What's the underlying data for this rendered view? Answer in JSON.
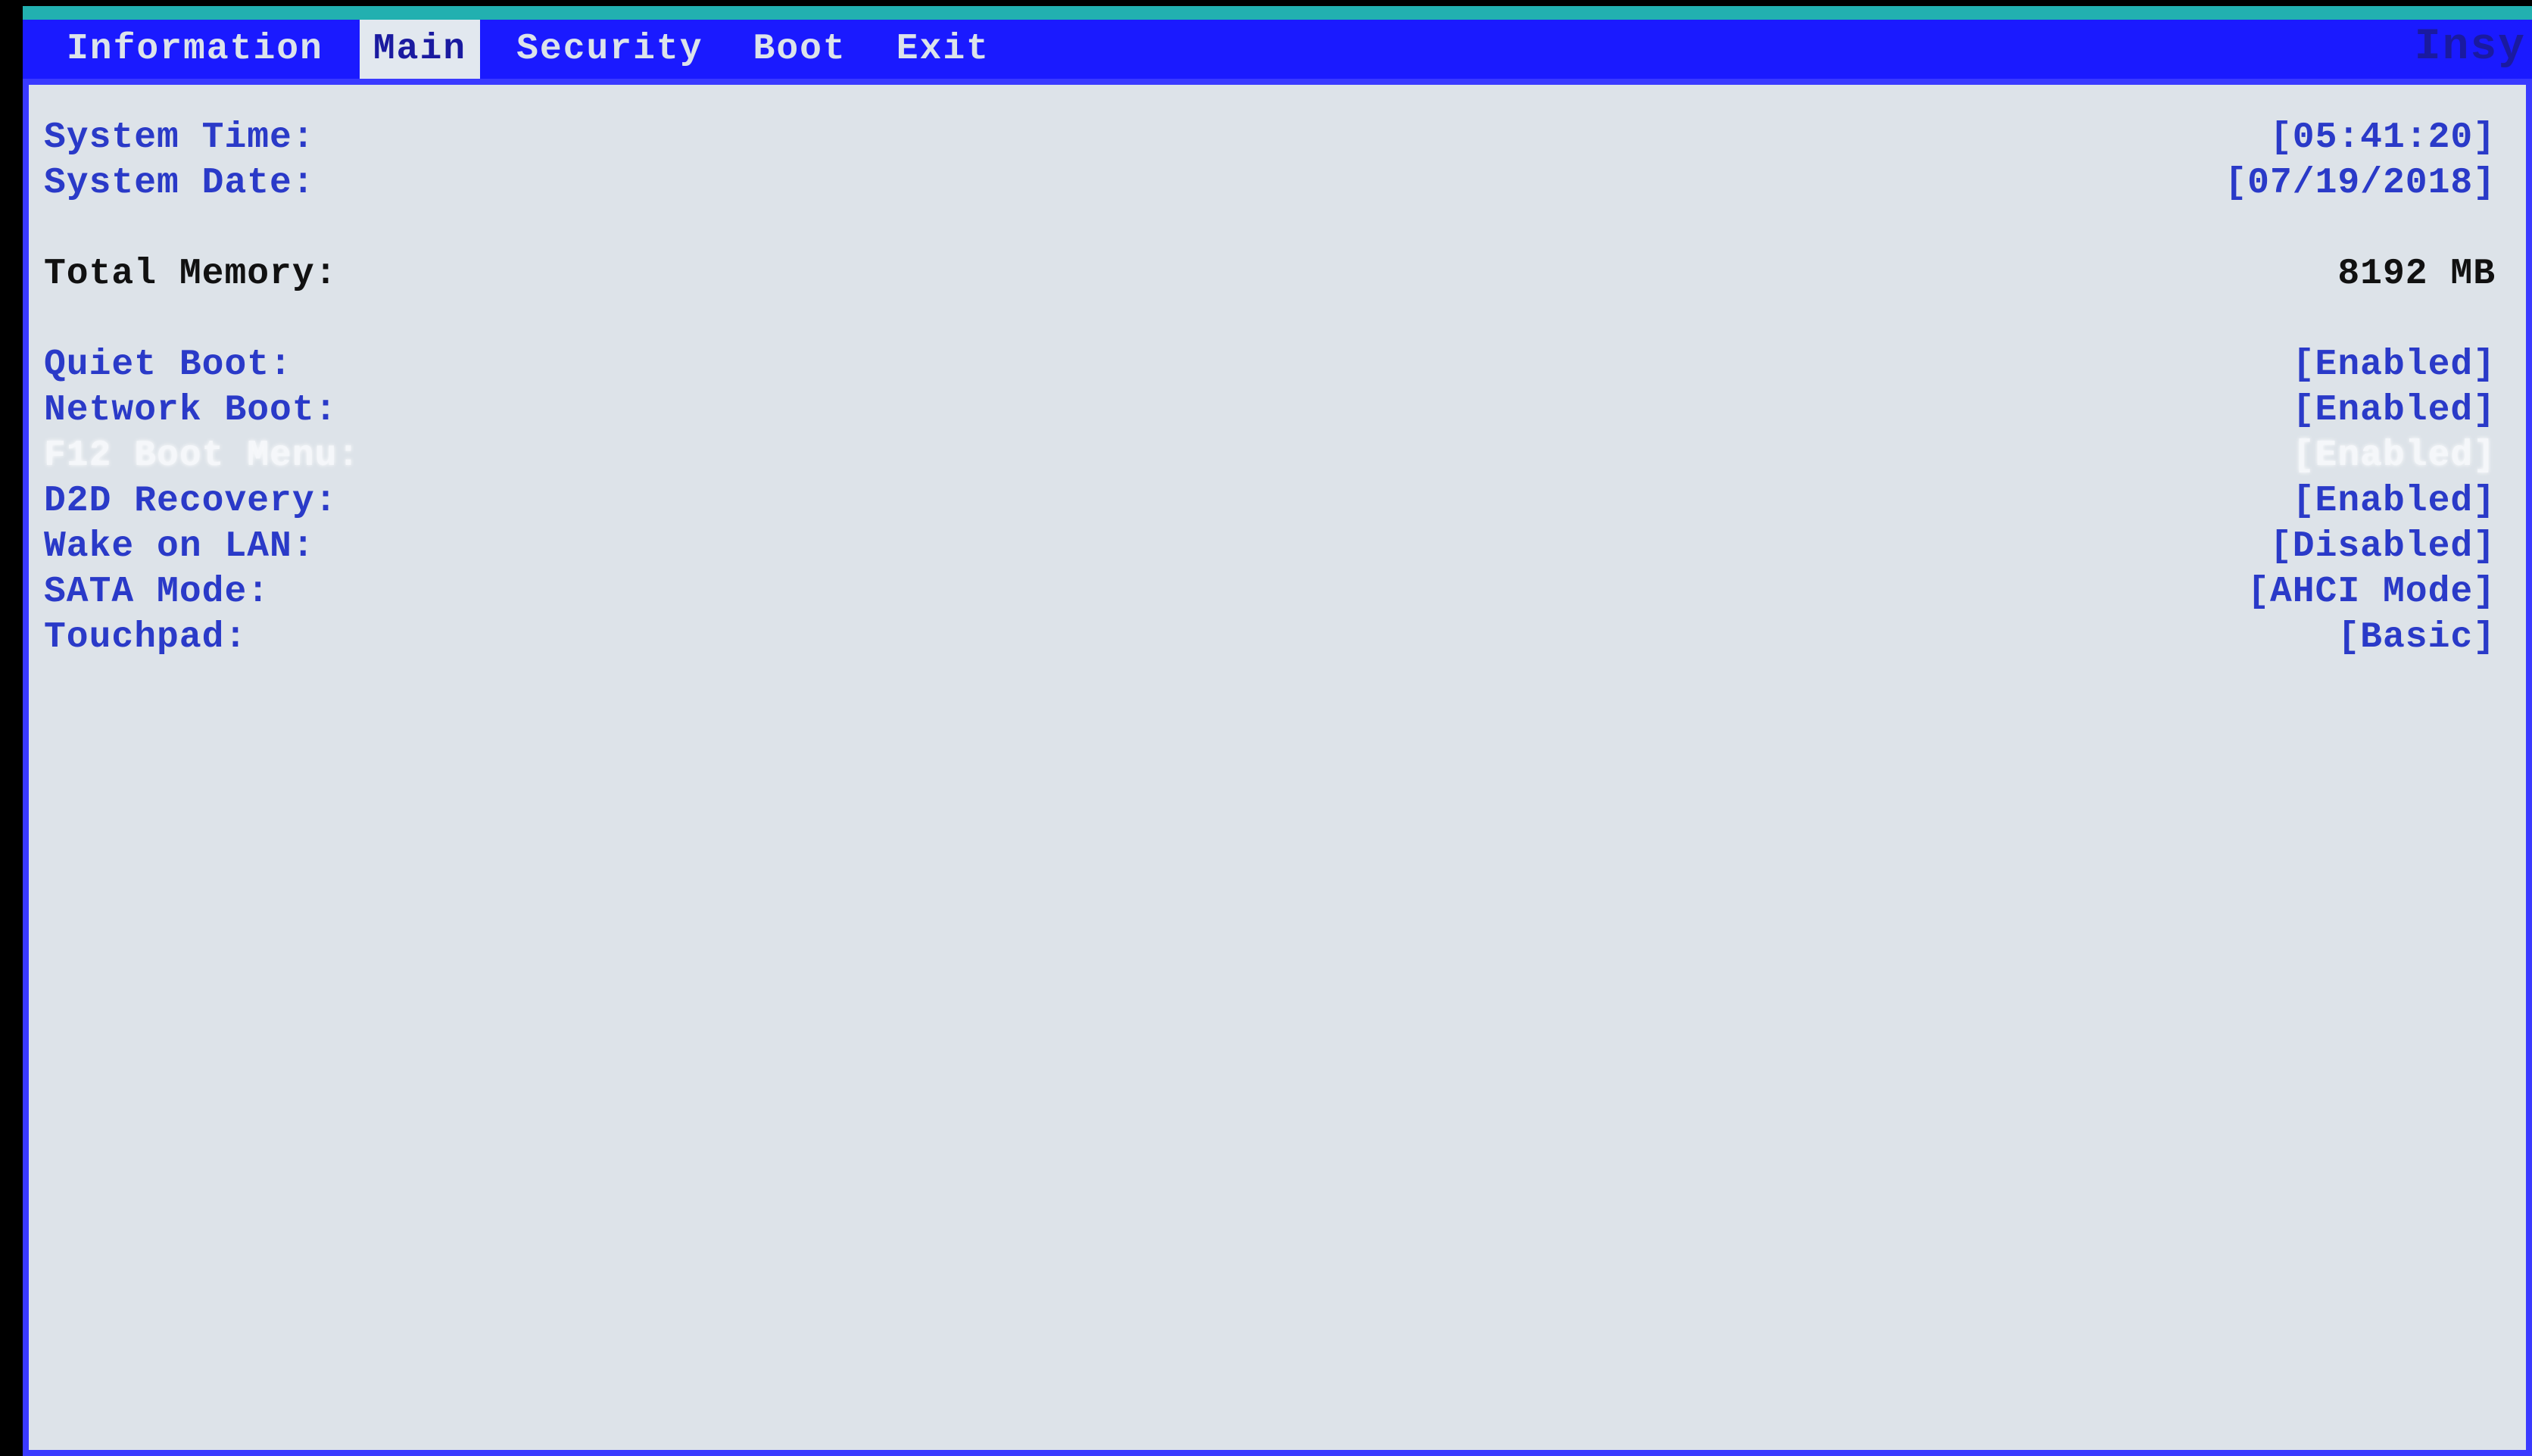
{
  "vendor_partial": "Insy",
  "tabs": {
    "information": "Information",
    "main": "Main",
    "security": "Security",
    "boot": "Boot",
    "exit": "Exit"
  },
  "main": {
    "system_time_label": "System Time:",
    "system_time_value": "[05:41:20]",
    "system_date_label": "System Date:",
    "system_date_value": "[07/19/2018]",
    "total_memory_label": "Total Memory:",
    "total_memory_value": "8192 MB",
    "quiet_boot_label": "Quiet Boot:",
    "quiet_boot_value": "[Enabled]",
    "network_boot_label": "Network Boot:",
    "network_boot_value": "[Enabled]",
    "f12_boot_menu_label": "F12 Boot Menu:",
    "f12_boot_menu_value": "[Enabled]",
    "d2d_recovery_label": "D2D Recovery:",
    "d2d_recovery_value": "[Enabled]",
    "wake_on_lan_label": "Wake on LAN:",
    "wake_on_lan_value": "[Disabled]",
    "sata_mode_label": "SATA Mode:",
    "sata_mode_value": "[AHCI Mode]",
    "touchpad_label": "Touchpad:",
    "touchpad_value": "[Basic]"
  }
}
